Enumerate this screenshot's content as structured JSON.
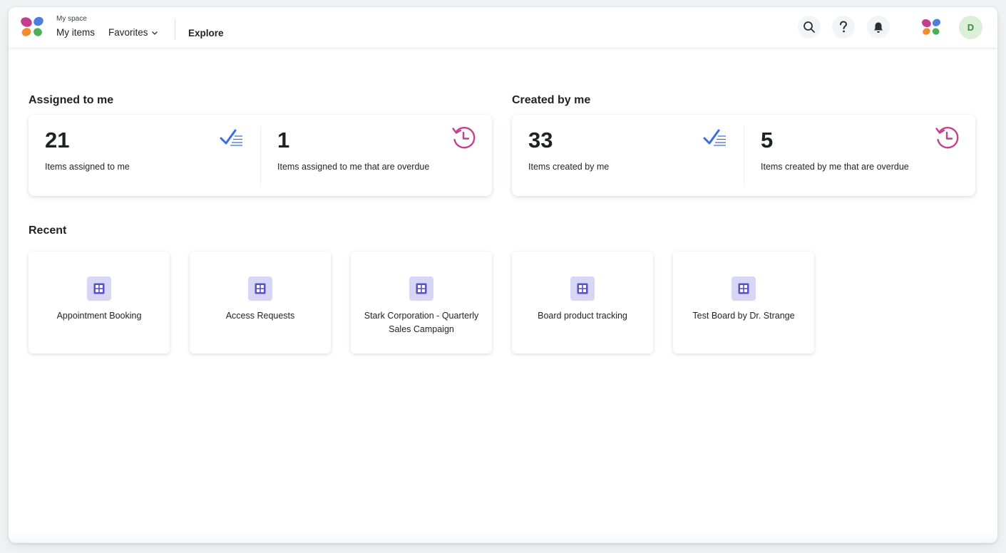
{
  "header": {
    "breadcrumb": "My space",
    "my_items": "My items",
    "favorites": "Favorites",
    "explore": "Explore",
    "avatar_initial": "D",
    "icons": [
      "search-icon",
      "help-icon",
      "bell-icon",
      "app-logo"
    ]
  },
  "assigned": {
    "title": "Assigned to me",
    "total": {
      "value": "21",
      "label": "Items assigned to me",
      "icon": "checklist-icon"
    },
    "overdue": {
      "value": "1",
      "label": "Items assigned to me that are overdue",
      "icon": "history-clock-icon"
    }
  },
  "created": {
    "title": "Created by me",
    "total": {
      "value": "33",
      "label": "Items created by me",
      "icon": "checklist-icon"
    },
    "overdue": {
      "value": "5",
      "label": "Items created by me that are overdue",
      "icon": "history-clock-icon"
    }
  },
  "recent": {
    "title": "Recent",
    "items": [
      {
        "label": "Appointment Booking"
      },
      {
        "label": "Access Requests"
      },
      {
        "label": "Stark Corporation - Quarterly Sales Campaign"
      },
      {
        "label": "Board product tracking"
      },
      {
        "label": "Test Board by Dr. Strange"
      }
    ]
  },
  "colors": {
    "accent_blue": "#3b6ee0",
    "overdue_magenta": "#c2408f",
    "board_icon_bg": "#d8d6f5",
    "board_icon_fg": "#5a50c8",
    "avatar_bg": "#dcefd8"
  }
}
